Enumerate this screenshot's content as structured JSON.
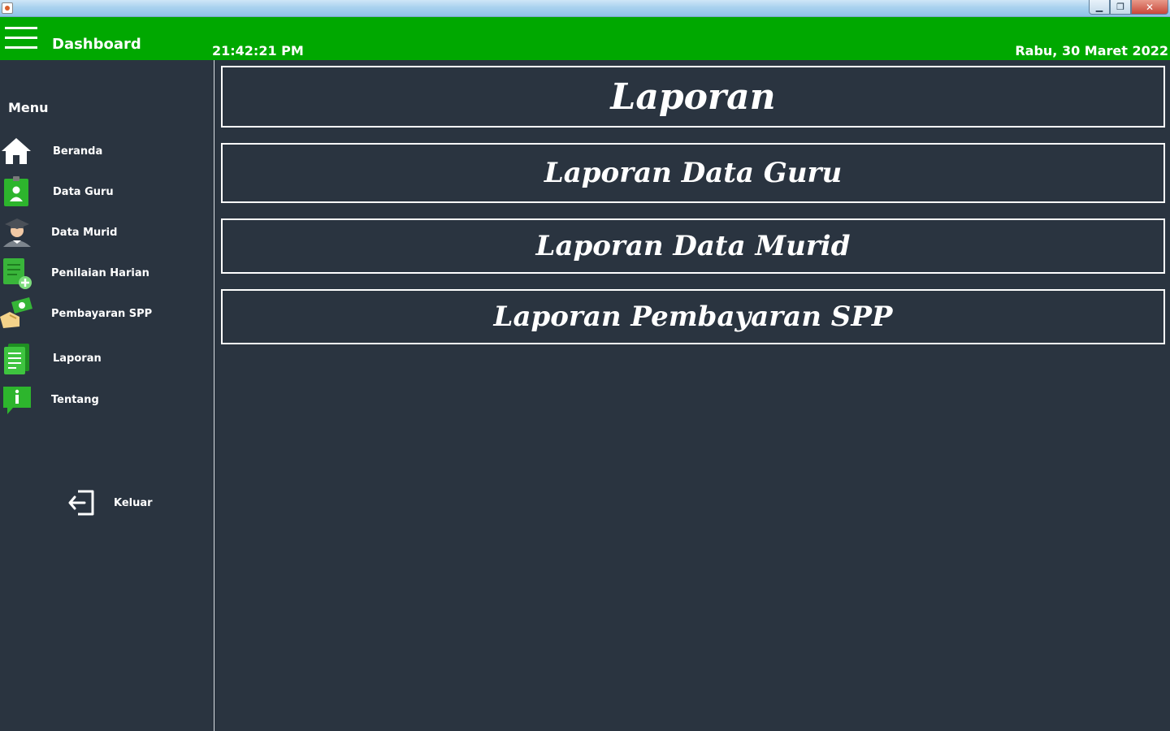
{
  "window": {
    "min_symbol": "▁",
    "max_symbol": "❐",
    "close_symbol": "✕"
  },
  "header": {
    "title": "Dashboard",
    "time": "21:42:21 PM",
    "date": "Rabu, 30 Maret 2022",
    "background_color": "#00a800"
  },
  "sidebar": {
    "heading": "Menu",
    "items": [
      {
        "label": "Beranda",
        "icon": "home-icon"
      },
      {
        "label": "Data Guru",
        "icon": "teacher-badge-icon"
      },
      {
        "label": "Data Murid",
        "icon": "student-graduate-icon"
      },
      {
        "label": "Penilaian Harian",
        "icon": "grade-sheet-add-icon"
      },
      {
        "label": "Pembayaran SPP",
        "icon": "payment-money-icon"
      },
      {
        "label": "Laporan",
        "icon": "report-document-icon"
      },
      {
        "label": "Tentang",
        "icon": "info-icon"
      }
    ],
    "logout": {
      "label": "Keluar",
      "icon": "logout-icon"
    }
  },
  "main": {
    "title": "Laporan",
    "buttons": [
      {
        "label": "Laporan Data Guru"
      },
      {
        "label": "Laporan Data Murid"
      },
      {
        "label": "Laporan Pembayaran SPP"
      }
    ]
  },
  "colors": {
    "panel_background": "#2a3440",
    "accent_green": "#00a800",
    "text": "#ffffff"
  }
}
